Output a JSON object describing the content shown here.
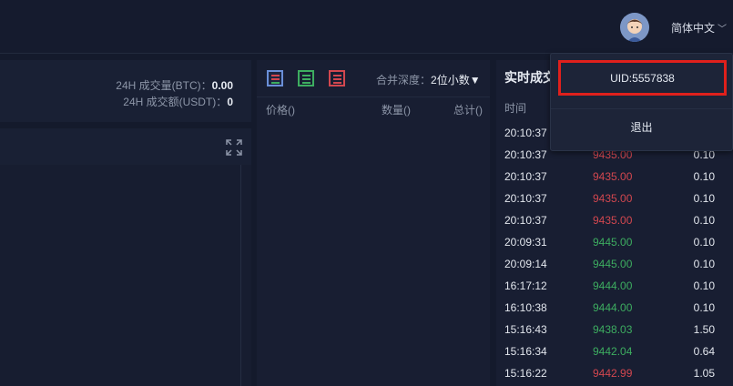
{
  "header": {
    "language": "简体中文"
  },
  "dropdown": {
    "uid": "UID:5557838",
    "logout": "退出"
  },
  "stats": {
    "volume_label": "24H 成交量(BTC)：",
    "volume_value": "0.00",
    "turnover_label": "24H 成交额(USDT)：",
    "turnover_value": "0"
  },
  "orderbook": {
    "depth_label": "合并深度：",
    "depth_value": "2位小数▼",
    "col_price": "价格()",
    "col_amount": "数量()",
    "col_total": "总计()"
  },
  "trades": {
    "title": "实时成交",
    "col_time": "时间",
    "rows": [
      {
        "time": "20:10:37",
        "price": "",
        "amount": "",
        "side": "sell"
      },
      {
        "time": "20:10:37",
        "price": "9435.00",
        "amount": "0.10",
        "side": "sell"
      },
      {
        "time": "20:10:37",
        "price": "9435.00",
        "amount": "0.10",
        "side": "sell"
      },
      {
        "time": "20:10:37",
        "price": "9435.00",
        "amount": "0.10",
        "side": "sell"
      },
      {
        "time": "20:10:37",
        "price": "9435.00",
        "amount": "0.10",
        "side": "sell"
      },
      {
        "time": "20:09:31",
        "price": "9445.00",
        "amount": "0.10",
        "side": "buy"
      },
      {
        "time": "20:09:14",
        "price": "9445.00",
        "amount": "0.10",
        "side": "buy"
      },
      {
        "time": "16:17:12",
        "price": "9444.00",
        "amount": "0.10",
        "side": "buy"
      },
      {
        "time": "16:10:38",
        "price": "9444.00",
        "amount": "0.10",
        "side": "buy"
      },
      {
        "time": "15:16:43",
        "price": "9438.03",
        "amount": "1.50",
        "side": "buy"
      },
      {
        "time": "15:16:34",
        "price": "9442.04",
        "amount": "0.64",
        "side": "buy"
      },
      {
        "time": "15:16:22",
        "price": "9442.99",
        "amount": "1.05",
        "side": "sell"
      }
    ]
  },
  "colors": {
    "sell": "#d2474f",
    "buy": "#3dad60",
    "highlight": "#e0201c"
  }
}
